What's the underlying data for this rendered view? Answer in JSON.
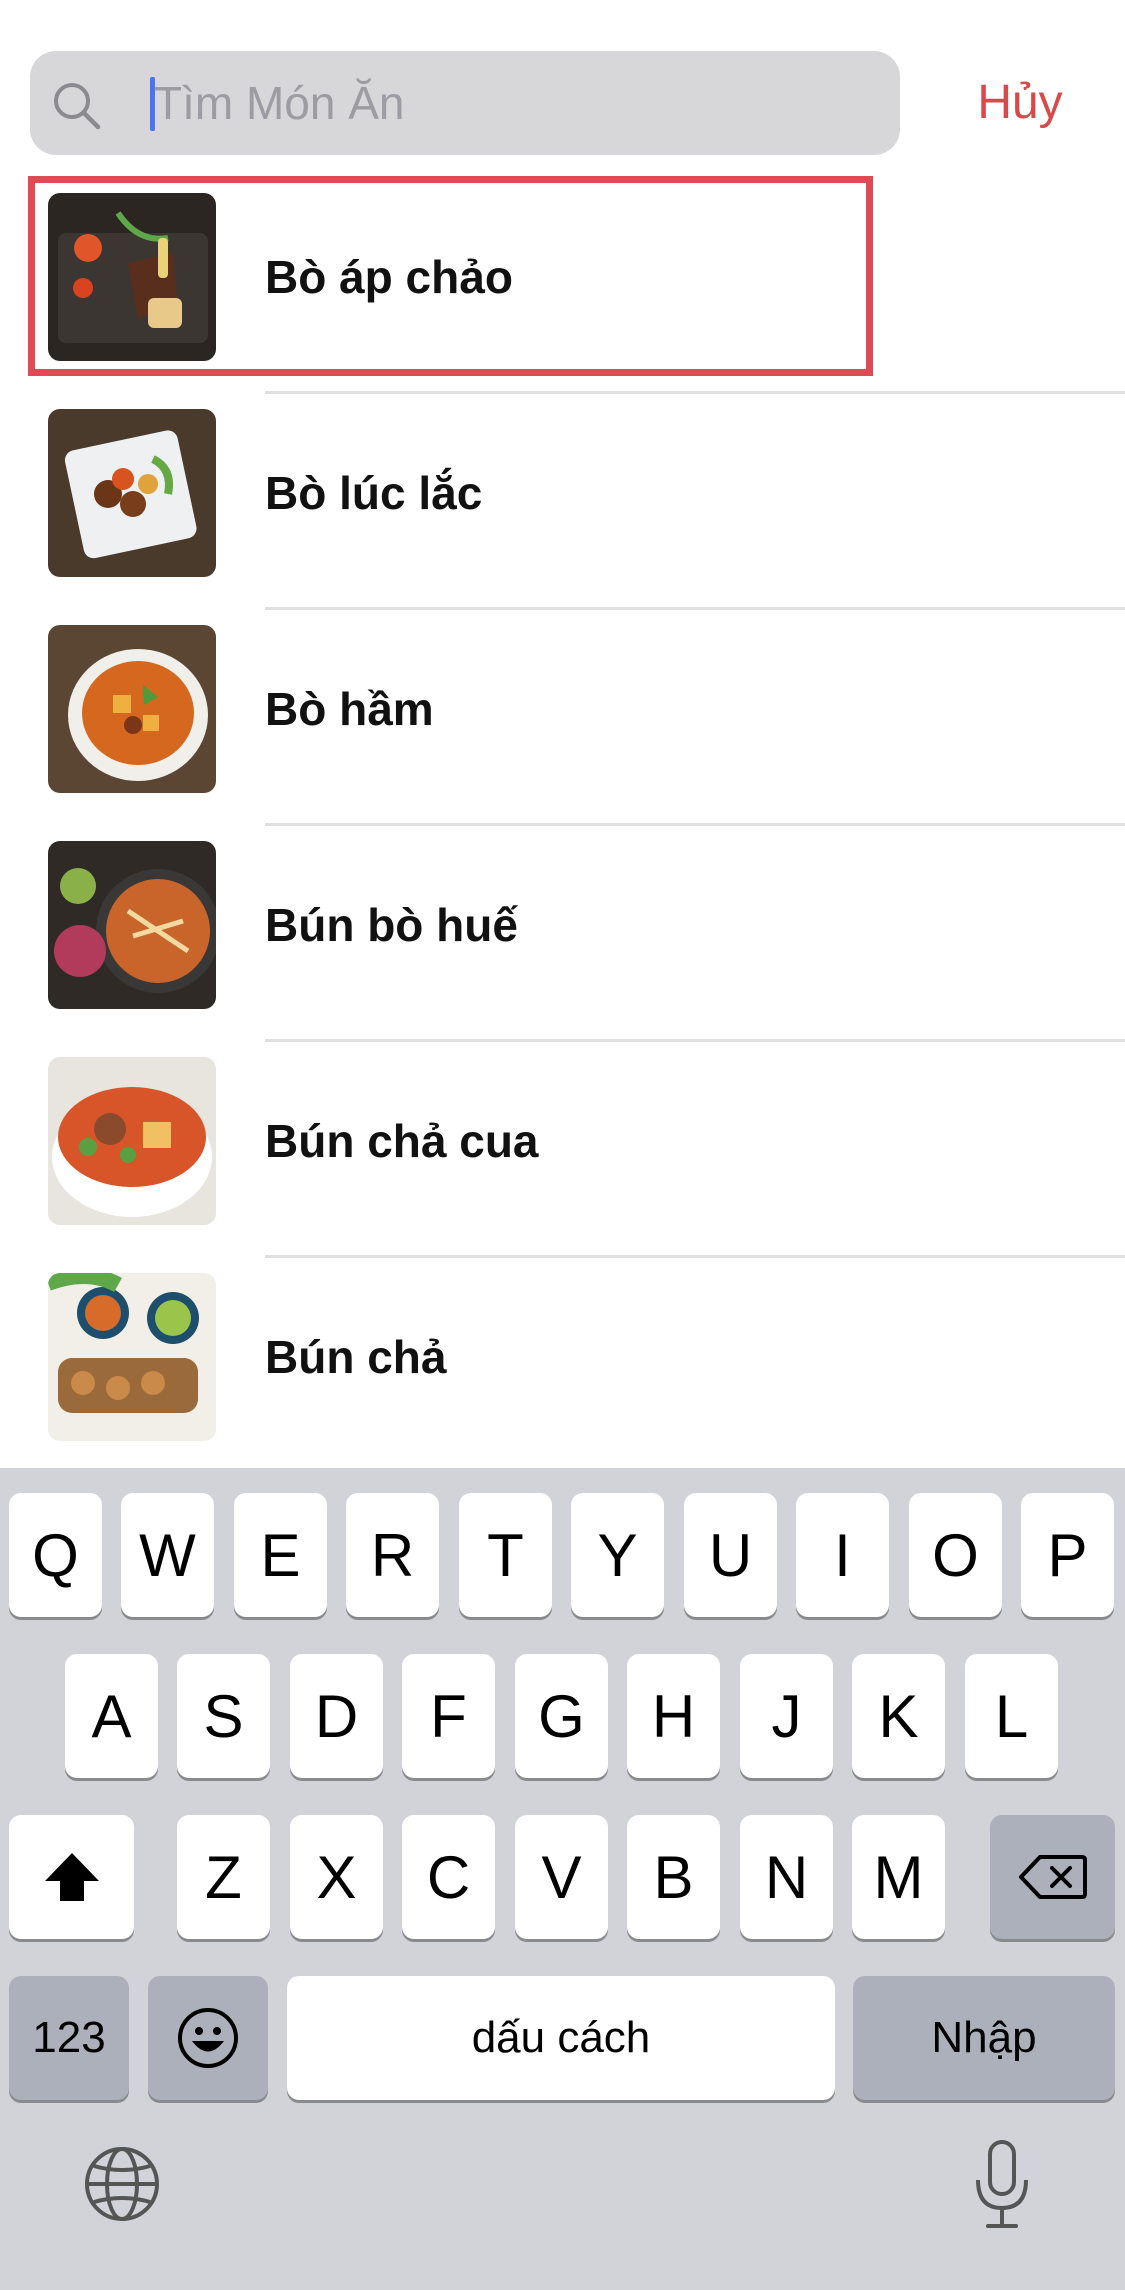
{
  "search": {
    "placeholder": "Tìm Món Ăn",
    "value": "",
    "cancel_label": "Hủy"
  },
  "foods": [
    {
      "name": "Bò áp chảo",
      "highlighted": true
    },
    {
      "name": "Bò lúc lắc"
    },
    {
      "name": "Bò hầm"
    },
    {
      "name": "Bún bò huế"
    },
    {
      "name": "Bún chả cua"
    },
    {
      "name": "Bún chả"
    }
  ],
  "keyboard": {
    "row1": [
      "Q",
      "W",
      "E",
      "R",
      "T",
      "Y",
      "U",
      "I",
      "O",
      "P"
    ],
    "row2": [
      "A",
      "S",
      "D",
      "F",
      "G",
      "H",
      "J",
      "K",
      "L"
    ],
    "row3": [
      "Z",
      "X",
      "C",
      "V",
      "B",
      "N",
      "M"
    ],
    "numbers_label": "123",
    "space_label": "dấu cách",
    "return_label": "Nhập",
    "icons": {
      "shift": "shift-icon",
      "delete": "delete-icon",
      "emoji": "emoji-icon",
      "globe": "globe-icon",
      "mic": "microphone-icon"
    }
  },
  "colors": {
    "accent_cancel": "#d84a4a",
    "highlight_border": "#e04a55",
    "caret": "#4a74f0",
    "keyboard_bg": "#d1d3d9"
  }
}
